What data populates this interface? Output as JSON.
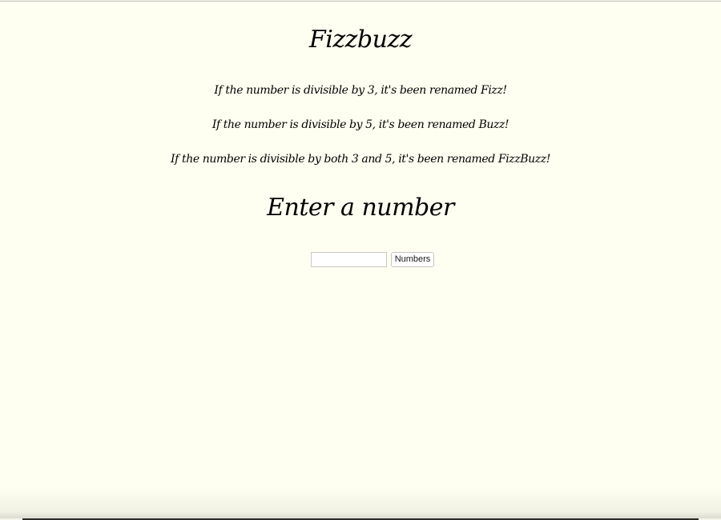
{
  "header": {
    "title": "Fizzbuzz"
  },
  "rules": [
    "If the number is divisible by 3, it's been renamed Fizz!",
    "If the number is divisible by 5, it's been renamed Buzz!",
    "If the number is divisible by both 3 and 5, it's been renamed FizzBuzz!"
  ],
  "form": {
    "heading": "Enter a number",
    "input_value": "",
    "input_placeholder": "",
    "button_label": "Numbers"
  },
  "colors": {
    "background": "#fffff1",
    "text": "#000000"
  }
}
